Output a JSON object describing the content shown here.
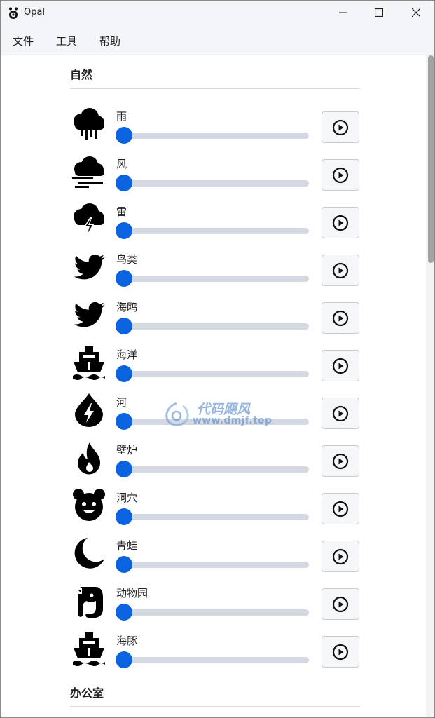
{
  "window": {
    "title": "Opal",
    "controls": [
      "minimize-icon",
      "maximize-icon",
      "close-icon"
    ]
  },
  "menu": [
    "文件",
    "工具",
    "帮助"
  ],
  "sections": [
    {
      "title": "自然",
      "sounds": [
        {
          "label": "雨",
          "icon": "rain-cloud-icon",
          "volume": 0
        },
        {
          "label": "风",
          "icon": "wind-cloud-icon",
          "volume": 0
        },
        {
          "label": "雷",
          "icon": "thunder-cloud-icon",
          "volume": 0
        },
        {
          "label": "鸟类",
          "icon": "bird-icon",
          "volume": 0
        },
        {
          "label": "海鸥",
          "icon": "bird-icon",
          "volume": 0
        },
        {
          "label": "海洋",
          "icon": "ship-icon",
          "volume": 0
        },
        {
          "label": "河",
          "icon": "water-drop-icon",
          "volume": 0
        },
        {
          "label": "壁炉",
          "icon": "flame-icon",
          "volume": 0
        },
        {
          "label": "洞穴",
          "icon": "bear-icon",
          "volume": 0
        },
        {
          "label": "青蛙",
          "icon": "moon-icon",
          "volume": 0
        },
        {
          "label": "动物园",
          "icon": "elephant-icon",
          "volume": 0
        },
        {
          "label": "海豚",
          "icon": "ship-icon",
          "volume": 0
        }
      ]
    },
    {
      "title": "办公室",
      "sounds": []
    }
  ],
  "watermark": {
    "name": "代码飓风",
    "url": "www.dmjf.top"
  },
  "colors": {
    "slider_thumb": "#0b63e0",
    "slider_track": "#d4d9e1",
    "titlebar_bg": "#f3f5f8"
  }
}
